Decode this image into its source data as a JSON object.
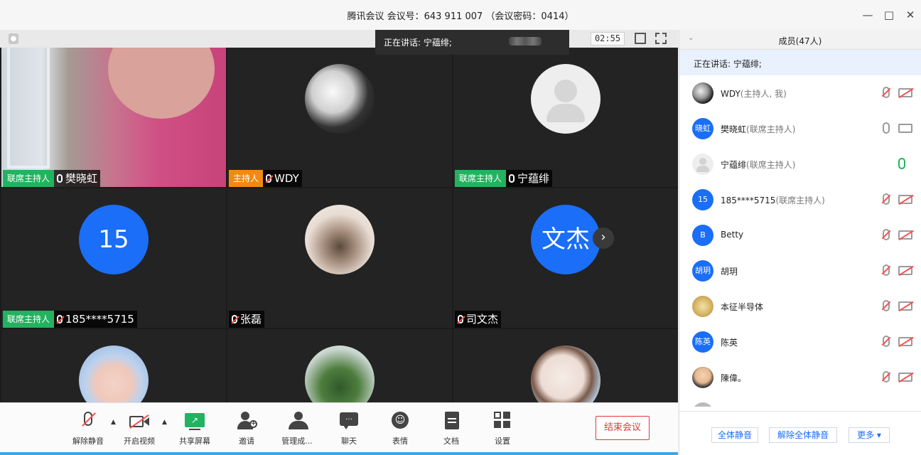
{
  "window": {
    "title": "腾讯会议 会议号：643 911 007 （会议密码：0414）",
    "min_icon": "minimize-icon",
    "max_icon": "maximize-icon",
    "close_icon": "close-icon"
  },
  "video": {
    "timer": "02:55",
    "speaking_popup": "正在讲话: 宁蕴绯;",
    "tiles": [
      {
        "role": "联席主持人",
        "role_type": "cohost",
        "name": "樊晓虹",
        "mic": "on",
        "avatar": "camera-feed"
      },
      {
        "role": "主持人",
        "role_type": "host",
        "name": "WDY",
        "mic": "off",
        "avatar": "photo"
      },
      {
        "role": "联席主持人",
        "role_type": "cohost",
        "name": "宁蕴绯",
        "mic": "on",
        "avatar": "default"
      },
      {
        "role": "联席主持人",
        "role_type": "cohost",
        "name": "185****5715",
        "mic": "off",
        "avatar_text": "15"
      },
      {
        "role": "",
        "role_type": "",
        "name": "张磊",
        "mic": "off",
        "avatar": "photo"
      },
      {
        "role": "",
        "role_type": "",
        "name": "司文杰",
        "mic": "off",
        "avatar_text": "文杰"
      },
      {
        "role": "",
        "name": "",
        "avatar": "photo"
      },
      {
        "role": "",
        "name": "",
        "avatar": "photo"
      },
      {
        "role": "",
        "name": "",
        "avatar": "photo"
      }
    ]
  },
  "toolbar": {
    "unmute": "解除静音",
    "video": "开启视频",
    "share": "共享屏幕",
    "invite": "邀请",
    "manage": "管理成...",
    "chat": "聊天",
    "emoji": "表情",
    "docs": "文档",
    "settings": "设置",
    "end": "结束会议"
  },
  "panel": {
    "title": "成员(47人)",
    "speaking": "正在讲话: 宁蕴绯;",
    "members": [
      {
        "name": "WDY",
        "sub": "(主持人, 我)",
        "avatar": "photo",
        "mic": "off",
        "cam": "off"
      },
      {
        "name": "樊晓虹",
        "sub": "(联席主持人)",
        "avatar_text": "晓虹",
        "mic": "muted-grey",
        "cam": "on"
      },
      {
        "name": "宁蕴绯",
        "sub": "(联席主持人)",
        "avatar": "default",
        "mic": "on",
        "cam": "none"
      },
      {
        "name": "185****5715",
        "sub": "(联席主持人)",
        "avatar_text": "15",
        "mic": "off",
        "cam": "off"
      },
      {
        "name": "Betty",
        "sub": "",
        "avatar_text": "B",
        "mic": "off",
        "cam": "off"
      },
      {
        "name": " 胡玥",
        "sub": "",
        "avatar_text": "胡玥",
        "mic": "off",
        "cam": "off"
      },
      {
        "name": "本征半导体",
        "sub": "",
        "avatar": "photo",
        "mic": "off",
        "cam": "off"
      },
      {
        "name": "陈英",
        "sub": "",
        "avatar_text": "陈英",
        "mic": "off",
        "cam": "off"
      },
      {
        "name": "陳偉。",
        "sub": "",
        "avatar": "photo",
        "mic": "off",
        "cam": "off"
      }
    ],
    "mute_all": "全体静音",
    "unmute_all": "解除全体静音",
    "more": "更多 ▾"
  },
  "colors": {
    "cohost_tag": "#21b35f",
    "host_tag": "#f08a11",
    "accent": "#1a6ef7",
    "end": "#e0373a"
  }
}
